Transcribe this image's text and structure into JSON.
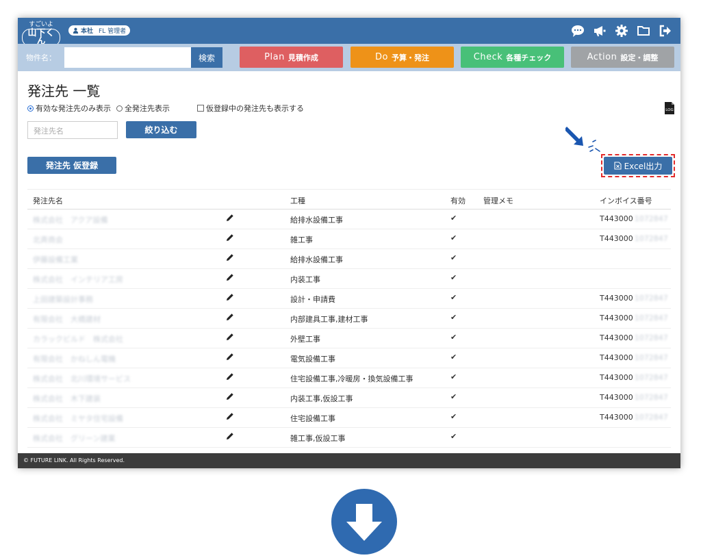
{
  "header": {
    "logo_line1": "すごいよ",
    "logo_line2": "山下くん",
    "office": "本社",
    "role": "FL 管理者"
  },
  "search": {
    "label": "物件名：",
    "value": "",
    "button": "検索"
  },
  "tabs": [
    {
      "en": "Plan",
      "ja": "見積作成",
      "color": "#de5f61"
    },
    {
      "en": "Do",
      "ja": "予算・発注",
      "color": "#ee9218"
    },
    {
      "en": "Check",
      "ja": "各種チェック",
      "color": "#48c078"
    },
    {
      "en": "Action",
      "ja": "設定・調整",
      "color": "#a0a3a6"
    }
  ],
  "page": {
    "title": "発注先 一覧",
    "radio_active": "有効な発注先のみ表示",
    "radio_all": "全発注先表示",
    "checkbox_provisional": "仮登録中の発注先も表示する",
    "log_icon_label": "LOG",
    "filter_placeholder": "発注先名",
    "filter_button": "絞り込む",
    "register_button": "発注先 仮登録",
    "excel_button": "Excel出力"
  },
  "table": {
    "columns": {
      "name": "発注先名",
      "kind": "工種",
      "valid": "有効",
      "memo": "管理メモ",
      "invoice": "インボイス番号"
    },
    "rows": [
      {
        "name": "株式会社　アクア設備",
        "kind": "給排水設備工事",
        "valid": "✔",
        "invoice": "T443000",
        "inv_rest": "1072847"
      },
      {
        "name": "北斉商会",
        "kind": "雑工事",
        "valid": "✔",
        "invoice": "T443000",
        "inv_rest": "1072847"
      },
      {
        "name": "伊藤設備工業",
        "kind": "給排水設備工事",
        "valid": "✔",
        "invoice": "",
        "inv_rest": ""
      },
      {
        "name": "株式会社　インテリア工房",
        "kind": "内装工事",
        "valid": "✔",
        "invoice": "",
        "inv_rest": ""
      },
      {
        "name": "上田建築設計事務",
        "kind": "設計・申請費",
        "valid": "✔",
        "invoice": "T443000",
        "inv_rest": "1072847"
      },
      {
        "name": "有限会社　大橋建材",
        "kind": "内部建具工事,建材工事",
        "valid": "✔",
        "invoice": "T443000",
        "inv_rest": "1072847"
      },
      {
        "name": "カラックビルド　株式会社",
        "kind": "外壁工事",
        "valid": "✔",
        "invoice": "T443000",
        "inv_rest": "1072847"
      },
      {
        "name": "有限会社　かねしん電機",
        "kind": "電気設備工事",
        "valid": "✔",
        "invoice": "T443000",
        "inv_rest": "1072847"
      },
      {
        "name": "株式会社　北川環境サービス",
        "kind": "住宅設備工事,冷暖房・換気設備工事",
        "valid": "✔",
        "invoice": "T443000",
        "inv_rest": "1072847"
      },
      {
        "name": "株式会社　木下建装",
        "kind": "内装工事,仮設工事",
        "valid": "✔",
        "invoice": "T443000",
        "inv_rest": "1072847"
      },
      {
        "name": "株式会社　ミヤタ住宅設備",
        "kind": "住宅設備工事",
        "valid": "✔",
        "invoice": "T443000",
        "inv_rest": "1072847"
      },
      {
        "name": "株式会社　グリーン建業",
        "kind": "雑工事,仮設工事",
        "valid": "✔",
        "invoice": "",
        "inv_rest": ""
      }
    ]
  },
  "footer": {
    "copyright": "© FUTURE LINK. All Rights Reserved."
  }
}
